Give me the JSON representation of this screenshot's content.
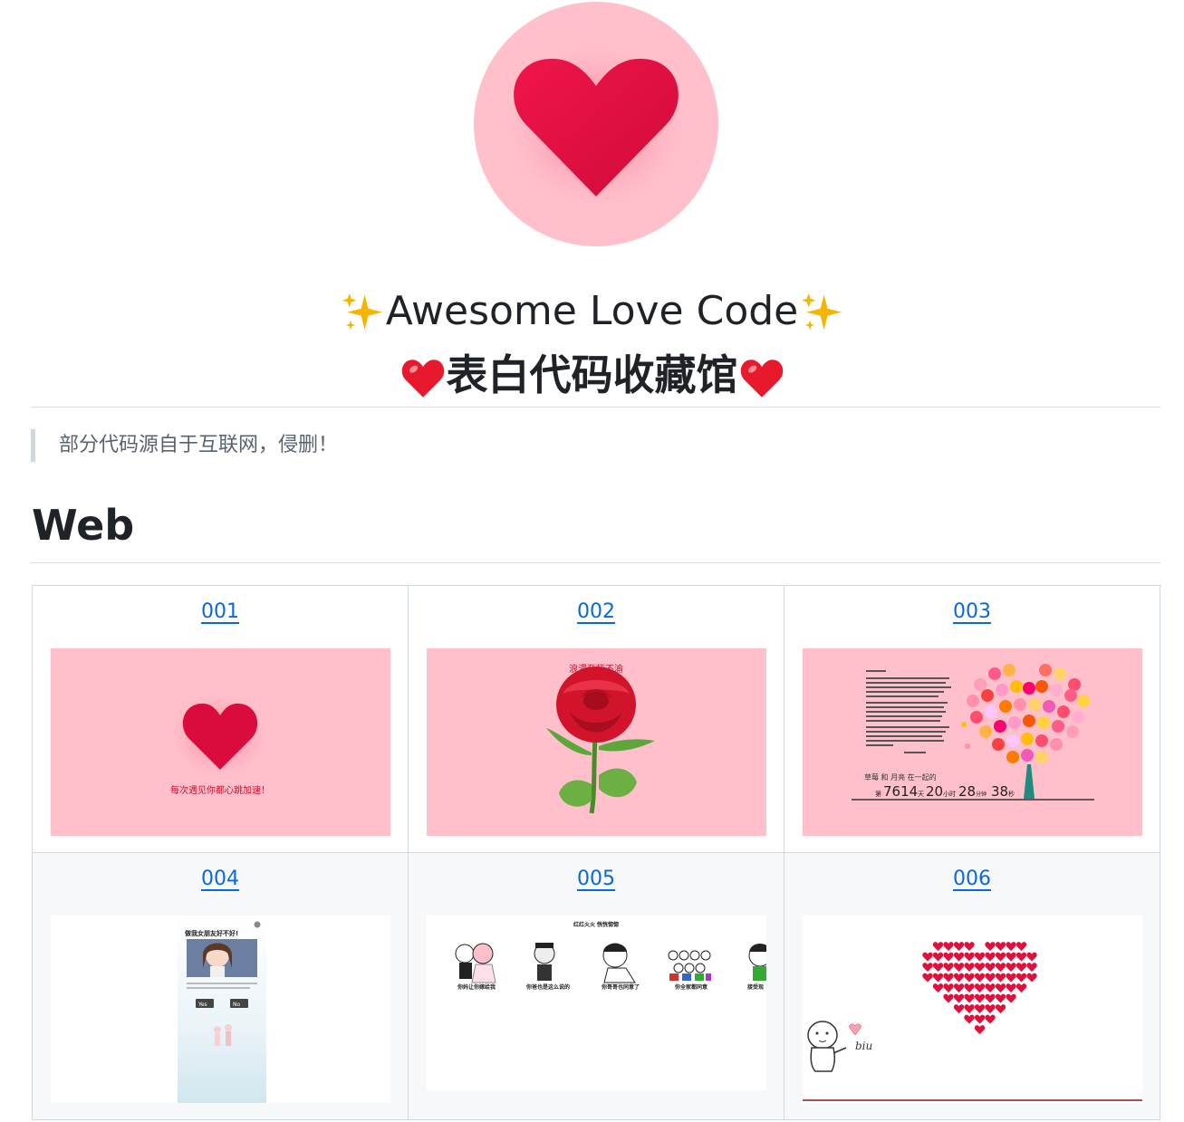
{
  "header": {
    "title_en": "Awesome Love Code",
    "title_zh": "表白代码收藏馆",
    "sparkle_icon": "sparkles-icon",
    "heart_icon": "red-heart-icon"
  },
  "notice": "部分代码源自于互联网，侵删！",
  "section": {
    "title": "Web"
  },
  "colors": {
    "link": "#0969da",
    "thumb_pink": "#ffc0cb",
    "heart": "#e0103c"
  },
  "items": [
    {
      "label": "001",
      "caption": "每次遇见你都心跳加速！"
    },
    {
      "label": "002",
      "caption": "浪漫至死不渝"
    },
    {
      "label": "003",
      "caption": "草莓 和 月亮 在一起的",
      "counter": {
        "prefix": "第",
        "days": "7614",
        "days_unit": "天",
        "hours": "20",
        "hours_unit": "小时",
        "minutes": "28",
        "minutes_unit": "分钟",
        "seconds": "38",
        "seconds_unit": "秒"
      }
    },
    {
      "label": "004",
      "caption": "做我女朋友好不好!",
      "yes": "Yes",
      "no": "No"
    },
    {
      "label": "005",
      "caption": "红红火火 恍恍惚惚",
      "stickers": [
        "你妈让你嫁给我",
        "你爸也是这么说的",
        "你哥哥也同意了",
        "你全家都同意",
        "接受现"
      ]
    },
    {
      "label": "006",
      "caption": "biu"
    }
  ]
}
